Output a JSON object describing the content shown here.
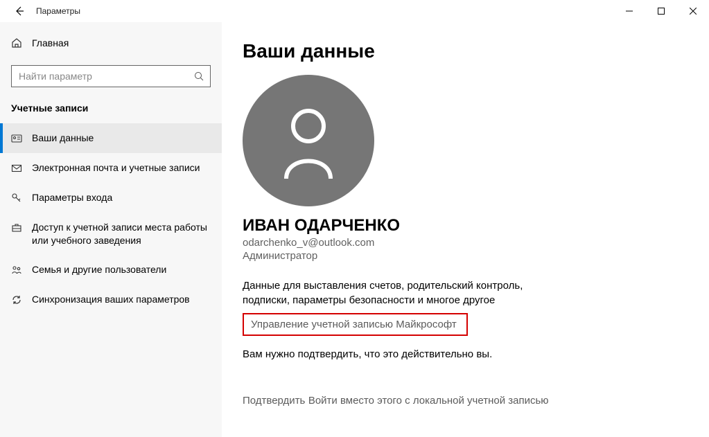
{
  "window": {
    "title": "Параметры"
  },
  "search": {
    "placeholder": "Найти параметр"
  },
  "sidebar": {
    "home_label": "Главная",
    "section_title": "Учетные записи",
    "items": [
      {
        "label": "Ваши данные"
      },
      {
        "label": "Электронная почта и учетные записи"
      },
      {
        "label": "Параметры входа"
      },
      {
        "label": "Доступ к учетной записи места работы или учебного заведения"
      },
      {
        "label": "Семья и другие пользователи"
      },
      {
        "label": "Синхронизация ваших параметров"
      }
    ]
  },
  "page": {
    "title": "Ваши данные",
    "user_name": "ИВАН ОДАРЧЕНКО",
    "user_email": "odarchenko_v@outlook.com",
    "user_role": "Администратор",
    "desc_text": "Данные для выставления счетов, родительский контроль, подписки, параметры безопасности и многое другое",
    "manage_link": "Управление учетной записью Майкрософт",
    "verify_text": "Вам нужно подтвердить, что это действительно вы.",
    "verify_link": "Подтвердить",
    "local_account_link": "Войти вместо этого с локальной учетной записью"
  }
}
